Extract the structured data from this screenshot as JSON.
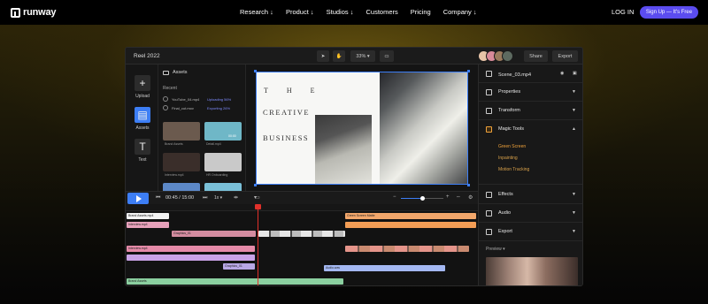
{
  "nav": {
    "logo": "runway",
    "links": [
      "Research ↓",
      "Product ↓",
      "Studios ↓",
      "Customers",
      "Pricing",
      "Company ↓"
    ],
    "login": "LOG IN",
    "signup": "Sign Up — It's Free"
  },
  "editor": {
    "project_title": "Reel 2022",
    "zoom": "33%",
    "share": "Share",
    "export": "Export",
    "rail": [
      "Upload",
      "Assets",
      "Text"
    ],
    "assets": {
      "title": "Assets",
      "recent_label": "Recent",
      "uploads": [
        {
          "name": "YouTube_04.mp4",
          "status": "Uploading 56%"
        },
        {
          "name": "Final_cut.mov",
          "status": "Exporting 26%"
        }
      ],
      "thumbnails": [
        {
          "caption": "Brand Assets",
          "color": "#6b5a4e"
        },
        {
          "caption": "Detail.mp4",
          "color": "#6fb7c7",
          "badge": "00:00"
        },
        {
          "caption": "Interview.mp4",
          "color": "#3a2e2a"
        },
        {
          "caption": "HR Onboarding",
          "color": "#c9c9c9"
        },
        {
          "caption": "",
          "color": "#5c88c7"
        },
        {
          "caption": "",
          "color": "#7ac0d8"
        }
      ]
    },
    "canvas": {
      "letters": [
        "T",
        "H",
        "E"
      ],
      "line2": "CREATIVE",
      "line3": "BUSINESS"
    },
    "right_panel": {
      "scene": "Scene_03.mp4",
      "sections": [
        "Properties",
        "Transform",
        "Magic Tools"
      ],
      "magic_tools": [
        "Green Screen",
        "Inpainting",
        "Motion Tracking"
      ],
      "more_sections": [
        "Effects",
        "Audio",
        "Export"
      ],
      "preview_label": "Preview"
    },
    "timeline": {
      "timecode": "00:45 / 15:00",
      "speed": "1x",
      "clips": [
        {
          "label": "Brand Assets.mp4",
          "color": "#f4f4f4"
        },
        {
          "label": "Interview.mp4",
          "color": "#e7a1ba"
        },
        {
          "label": "Graphics_01",
          "color": "#f39d55"
        },
        {
          "label": "Interview.mp4",
          "color": "#e58aa8"
        },
        {
          "label": "Green Screen Matte",
          "color": "#f3a76b"
        },
        {
          "label": "Graphics_01",
          "color": "#b8a7e6"
        },
        {
          "label": "Audio.wav",
          "color": "#a4b8f2"
        },
        {
          "label": "Brand Assets",
          "color": "#8bd0a0"
        }
      ]
    }
  }
}
